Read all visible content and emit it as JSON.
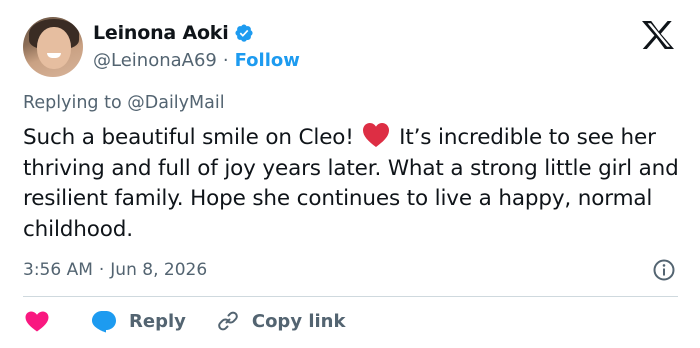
{
  "user": {
    "display_name": "Leinona Aoki",
    "handle": "@LeinonaA69",
    "separator": "·",
    "follow_label": "Follow",
    "verified": true
  },
  "reply_context": {
    "prefix": "Replying to",
    "target": "@DailyMail"
  },
  "tweet": {
    "text_before_emoji": "Such a beautiful smile on Cleo!",
    "emoji": "red-heart",
    "text_after_emoji": "It’s incredible to see her thriving and full of joy years later. What a strong little girl and resilient family. Hope she continues to live a happy, normal childhood."
  },
  "meta": {
    "time": "3:56 AM",
    "separator": "·",
    "date": "Jun 8, 2026"
  },
  "actions": {
    "reply_label": "Reply",
    "copy_link_label": "Copy link"
  },
  "colors": {
    "accent": "#1d9bf0",
    "like": "#f91880",
    "heart_emoji": "#dd2e44",
    "secondary_text": "#536471",
    "primary_text": "#0f1419",
    "divider": "#cfd9de"
  },
  "icons": [
    "verified-badge-icon",
    "x-logo-icon",
    "red-heart-emoji-icon",
    "info-icon",
    "heart-icon",
    "reply-bubble-icon",
    "link-icon"
  ]
}
